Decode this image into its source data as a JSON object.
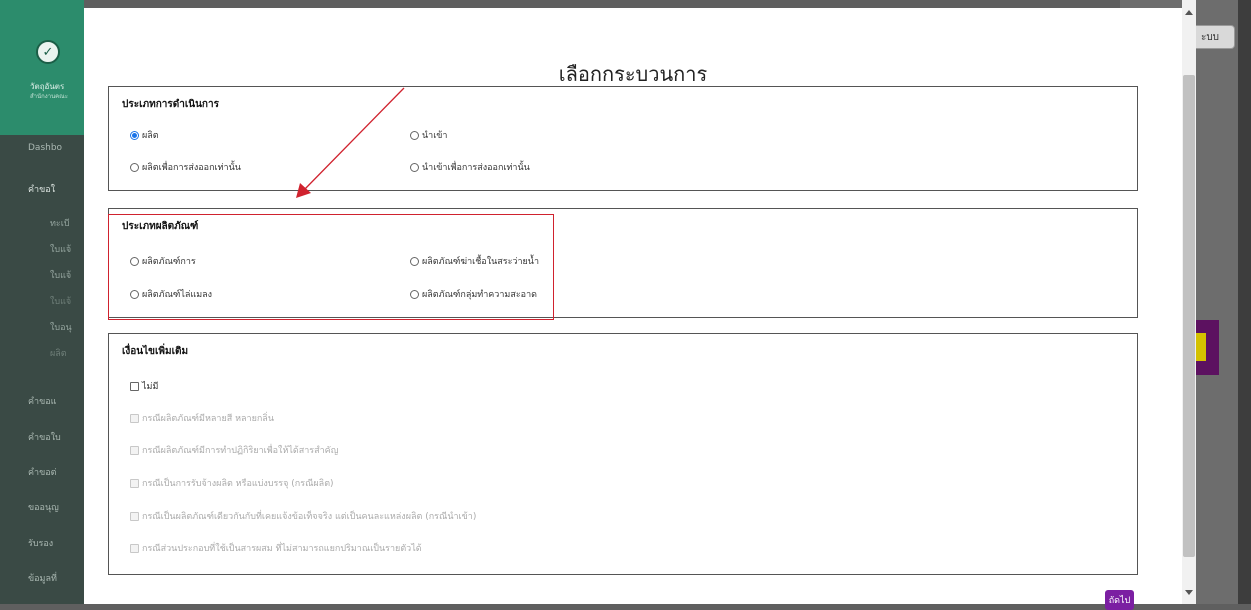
{
  "sidebar": {
    "org_name": "วัตถุอันตร",
    "org_sub": "สำนักงานคณะ",
    "items": [
      {
        "label": "Dashbo"
      },
      {
        "label": "คำขอใ"
      },
      {
        "label": "คำขอแ"
      },
      {
        "label": "คำขอใบ"
      },
      {
        "label": "คำขอต่"
      },
      {
        "label": "ขออนุญ"
      },
      {
        "label": "รับรอง"
      },
      {
        "label": "ข้อมูลที่"
      }
    ],
    "subitems": [
      "ทะเบี",
      "ใบแจ้",
      "ใบแจ้",
      "ใบแจ้",
      "ใบอนุ",
      "ผลิต"
    ]
  },
  "background": {
    "top_button": "ะบบ"
  },
  "modal": {
    "title": "เลือกกระบวนการ",
    "operation": {
      "title": "ประเภทการดำเนินการ",
      "options": [
        {
          "label": "ผลิต",
          "selected": true
        },
        {
          "label": "นำเข้า",
          "selected": false
        },
        {
          "label": "ผลิตเพื่อการส่งออกเท่านั้น",
          "selected": false
        },
        {
          "label": "นำเข้าเพื่อการส่งออกเท่านั้น",
          "selected": false
        }
      ]
    },
    "product": {
      "title": "ประเภทผลิตภัณฑ์",
      "options": [
        {
          "label": "ผลิตภัณฑ์การ"
        },
        {
          "label": "ผลิตภัณฑ์ฆ่าเชื้อในสระว่ายน้ำ"
        },
        {
          "label": "ผลิตภัณฑ์ไล่แมลง"
        },
        {
          "label": "ผลิตภัณฑ์กลุ่มทำความสะอาด"
        }
      ]
    },
    "conditions": {
      "title": "เงื่อนไขเพิ่มเติม",
      "options": [
        {
          "label": "ไม่มี",
          "enabled": true
        },
        {
          "label": "กรณีผลิตภัณฑ์มีหลายสี หลายกลิ่น",
          "enabled": false
        },
        {
          "label": "กรณีผลิตภัณฑ์มีการทำปฏิกิริยาเพื่อให้ได้สารสำคัญ",
          "enabled": false
        },
        {
          "label": "กรณีเป็นการรับจ้างผลิต หรือแบ่งบรรจุ (กรณีผลิต)",
          "enabled": false
        },
        {
          "label": "กรณีเป็นผลิตภัณฑ์เดียวกันกับที่เคยแจ้งข้อเท็จจริง แต่เป็นคนละแหล่งผลิต (กรณีนำเข้า)",
          "enabled": false
        },
        {
          "label": "กรณีส่วนประกอบที่ใช้เป็นสารผสม ที่ไม่สามารถแยกปริมาณเป็นรายตัวได้",
          "enabled": false
        }
      ]
    },
    "next_label": "ถัดไป"
  },
  "colors": {
    "sidebar_top": "#2c8c6c",
    "sidebar": "#3a4a45",
    "highlight": "#d0222e",
    "radio_selected": "#1a73e8",
    "next_button": "#7b1fa2"
  }
}
